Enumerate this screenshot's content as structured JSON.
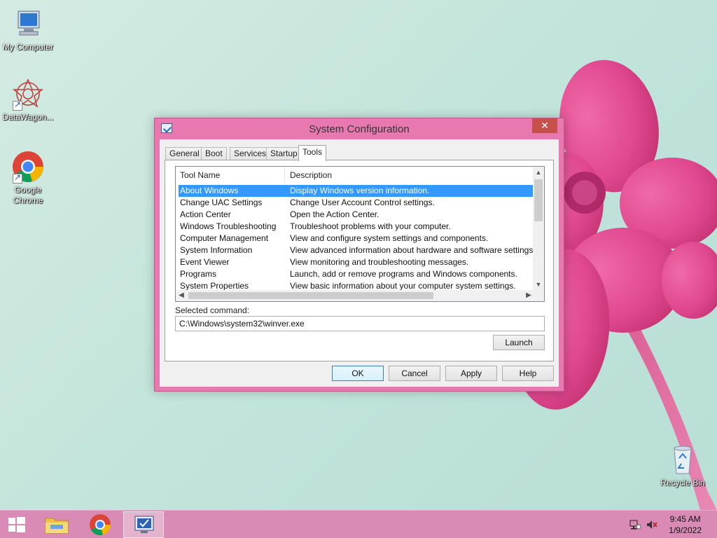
{
  "desktop": {
    "icons": [
      {
        "label": "My Computer",
        "icon": "my-computer-icon"
      },
      {
        "label": "DataWagon...",
        "icon": "datawagon-icon"
      },
      {
        "label": "Google Chrome",
        "icon": "chrome-icon"
      },
      {
        "label": "Recycle Bin",
        "icon": "recycle-bin-icon"
      }
    ]
  },
  "window": {
    "title": "System Configuration",
    "close_label": "✕",
    "tabs": [
      {
        "label": "General"
      },
      {
        "label": "Boot"
      },
      {
        "label": "Services"
      },
      {
        "label": "Startup"
      },
      {
        "label": "Tools"
      }
    ],
    "active_tab": "Tools",
    "list": {
      "columns": [
        "Tool Name",
        "Description"
      ],
      "rows": [
        {
          "name": "About Windows",
          "description": "Display Windows version information."
        },
        {
          "name": "Change UAC Settings",
          "description": "Change User Account Control settings."
        },
        {
          "name": "Action Center",
          "description": "Open the Action Center."
        },
        {
          "name": "Windows Troubleshooting",
          "description": "Troubleshoot problems with your computer."
        },
        {
          "name": "Computer Management",
          "description": "View and configure system settings and components."
        },
        {
          "name": "System Information",
          "description": "View advanced information about hardware and software settings."
        },
        {
          "name": "Event Viewer",
          "description": "View monitoring and troubleshooting messages."
        },
        {
          "name": "Programs",
          "description": "Launch, add or remove programs and Windows components."
        },
        {
          "name": "System Properties",
          "description": "View basic information about your computer system settings."
        }
      ],
      "selected_index": 0
    },
    "selected_command_label": "Selected command:",
    "selected_command_value": "C:\\Windows\\system32\\winver.exe",
    "buttons": {
      "launch": "Launch",
      "ok": "OK",
      "cancel": "Cancel",
      "apply": "Apply",
      "help": "Help"
    }
  },
  "taskbar": {
    "time": "9:45 AM",
    "date": "1/9/2022"
  },
  "colors": {
    "window_frame": "#e879b0",
    "close_button": "#c7504a",
    "selection": "#3399ff",
    "taskbar": "#d98bb6"
  }
}
